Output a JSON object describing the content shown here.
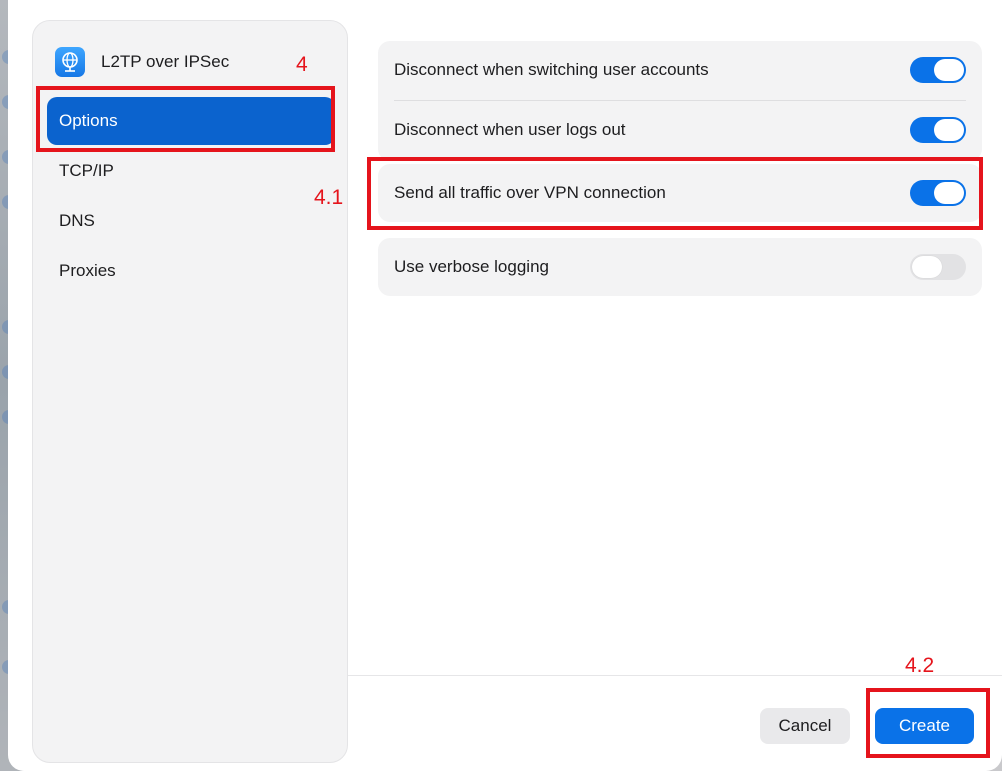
{
  "sidebar": {
    "title": "L2TP over IPSec",
    "icon": "vpn-globe-icon",
    "items": [
      {
        "label": "Options",
        "selected": true
      },
      {
        "label": "TCP/IP",
        "selected": false
      },
      {
        "label": "DNS",
        "selected": false
      },
      {
        "label": "Proxies",
        "selected": false
      }
    ]
  },
  "options": {
    "disconnect_switching": {
      "label": "Disconnect when switching user accounts",
      "on": true
    },
    "disconnect_logout": {
      "label": "Disconnect when user logs out",
      "on": true
    },
    "send_all_traffic": {
      "label": "Send all traffic over VPN connection",
      "on": true
    },
    "verbose_logging": {
      "label": "Use verbose logging",
      "on": false
    }
  },
  "footer": {
    "cancel_label": "Cancel",
    "create_label": "Create"
  },
  "annotations": {
    "step_4": "4",
    "step_4_1": "4.1",
    "step_4_2": "4.2",
    "color": "#e5141c"
  },
  "colors": {
    "accent": "#0a72e8",
    "selected_sidebar": "#0b63ce"
  }
}
